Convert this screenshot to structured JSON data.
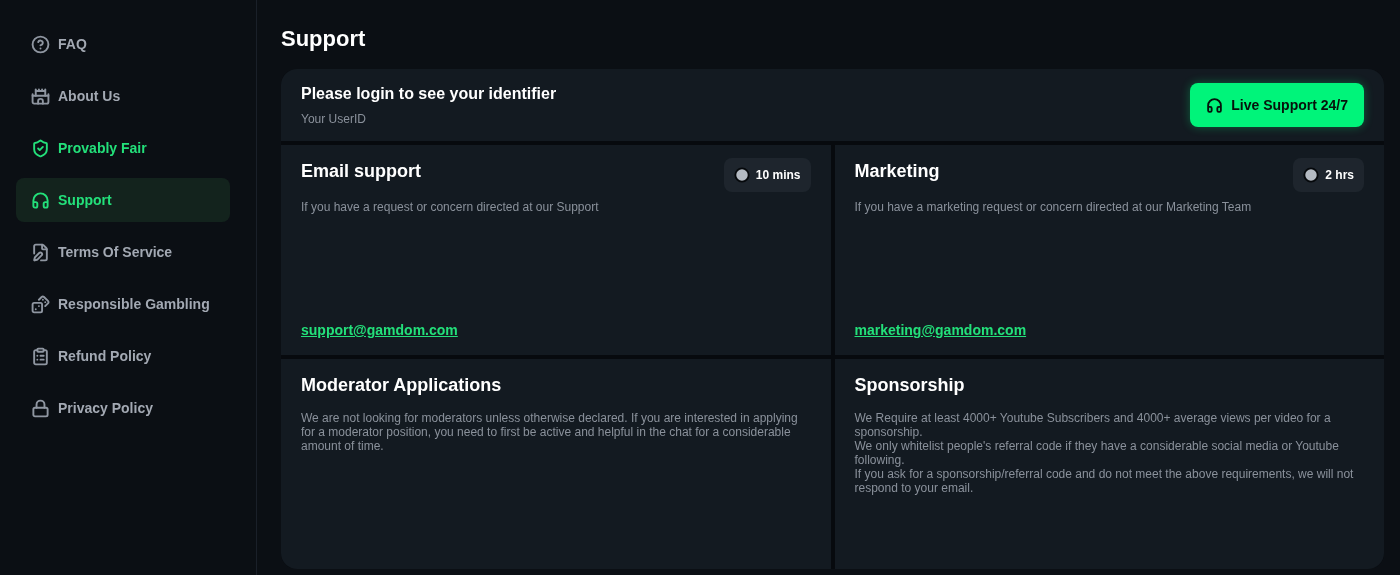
{
  "sidebar": {
    "items": [
      {
        "label": "FAQ",
        "selected": false,
        "highlighted": false
      },
      {
        "label": "About Us",
        "selected": false,
        "highlighted": false
      },
      {
        "label": "Provably Fair",
        "selected": false,
        "highlighted": true
      },
      {
        "label": "Support",
        "selected": true,
        "highlighted": true
      },
      {
        "label": "Terms Of Service",
        "selected": false,
        "highlighted": false
      },
      {
        "label": "Responsible Gambling",
        "selected": false,
        "highlighted": false
      },
      {
        "label": "Refund Policy",
        "selected": false,
        "highlighted": false
      },
      {
        "label": "Privacy Policy",
        "selected": false,
        "highlighted": false
      }
    ]
  },
  "page_title": "Support",
  "identifier": {
    "title": "Please login to see your identifier",
    "subtitle": "Your UserID",
    "button": "Live Support 24/7"
  },
  "sections": [
    {
      "title": "Email support",
      "response_time": "10 mins",
      "lines": [
        "If you have a request or concern directed at our Support"
      ],
      "email": "support@gamdom.com"
    },
    {
      "title": "Marketing",
      "response_time": "2 hrs",
      "lines": [
        "If you have a marketing request or concern directed at our Marketing Team"
      ],
      "email": "marketing@gamdom.com"
    },
    {
      "title": "Moderator Applications",
      "lines": [
        "We are not looking for moderators unless otherwise declared. If you are interested in applying for a moderator position, you need to first be active and helpful in the chat for a considerable amount of time."
      ]
    },
    {
      "title": "Sponsorship",
      "lines": [
        "We Require at least 4000+ Youtube Subscribers and 4000+ average views per video for a sponsorship.",
        "We only whitelist people's referral code if they have a considerable social media or Youtube following.",
        "If you ask for a sponsorship/referral code and do not meet the above requirements, we will not respond to your email."
      ]
    }
  ]
}
